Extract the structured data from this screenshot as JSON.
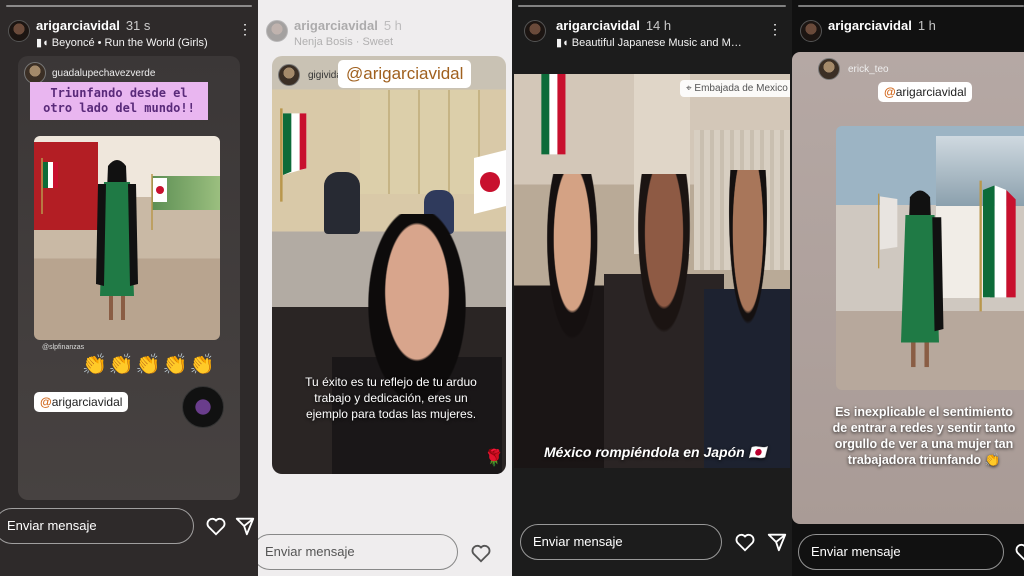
{
  "stories": [
    {
      "username": "arigarciavidal",
      "time": "31 s",
      "music": "Beyoncé • Run the World (Girls)",
      "repost_user": "guadalupechavezverde",
      "banner_line1": "Triunfando desde el",
      "banner_line2": "otro lado del mundo!!",
      "small_tag": "@slpfinanzas",
      "claps": "👏👏👏👏👏",
      "mention": "arigarciavidal",
      "message_placeholder": "Enviar mensaje"
    },
    {
      "username": "arigarciavidal",
      "time": "5 h",
      "music": "Nenja Bosis · Sweet",
      "repost_user": "gigividal05",
      "mention": "@arigarciavidal",
      "caption": "Tu éxito es tu reflejo de tu arduo trabajo y dedicación, eres un ejemplo para todas las mujeres.",
      "message_placeholder": "Enviar mensaje"
    },
    {
      "username": "arigarciavidal",
      "time": "14 h",
      "music": "Beautiful Japanese Music and M…",
      "location": "Embajada de Mexico",
      "caption": "México rompiéndola en Japón 🇯🇵",
      "message_placeholder": "Enviar mensaje"
    },
    {
      "username": "arigarciavidal",
      "time": "1 h",
      "repost_user": "erick_teo",
      "mention": "arigarciavidal",
      "caption_line1": "Es inexplicable el sentimiento",
      "caption_line2": "de entrar a redes y sentir tanto",
      "caption_line3": "orgullo de ver a una mujer tan",
      "caption_line4": "trabajadora triunfando 👏",
      "message_placeholder": "Enviar mensaje"
    }
  ],
  "icons": {
    "like": "heart-icon",
    "send": "paper-plane-icon",
    "more": "more-vertical-icon",
    "music": "music-note-icon",
    "location": "location-pin-icon"
  }
}
